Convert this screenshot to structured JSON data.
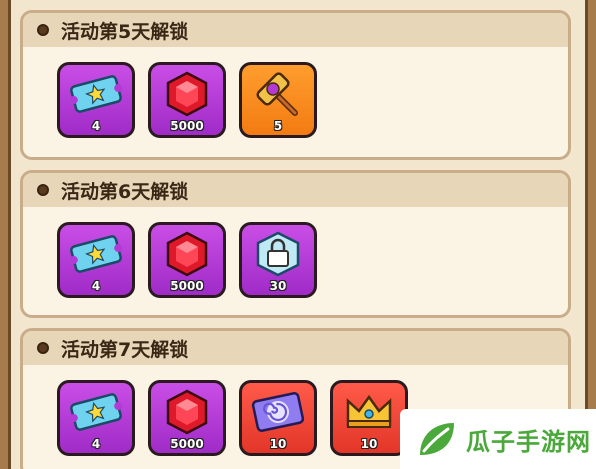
{
  "sections": [
    {
      "title": "活动第5天解锁",
      "items": [
        {
          "icon": "ticket-icon",
          "count": "4",
          "bg": "purple"
        },
        {
          "icon": "ruby-gem-icon",
          "count": "5000",
          "bg": "purple"
        },
        {
          "icon": "hammer-icon",
          "count": "5",
          "bg": "orange"
        }
      ]
    },
    {
      "title": "活动第6天解锁",
      "items": [
        {
          "icon": "ticket-icon",
          "count": "4",
          "bg": "purple"
        },
        {
          "icon": "ruby-gem-icon",
          "count": "5000",
          "bg": "purple"
        },
        {
          "icon": "lock-badge-icon",
          "count": "30",
          "bg": "purple"
        }
      ]
    },
    {
      "title": "活动第7天解锁",
      "items": [
        {
          "icon": "ticket-icon",
          "count": "4",
          "bg": "purple"
        },
        {
          "icon": "ruby-gem-icon",
          "count": "5000",
          "bg": "purple"
        },
        {
          "icon": "swirl-ticket-icon",
          "count": "10",
          "bg": "red"
        },
        {
          "icon": "crown-icon",
          "count": "10",
          "bg": "red"
        }
      ]
    }
  ],
  "watermark": {
    "text": "瓜子手游网",
    "icon": "leaf-logo-icon",
    "color": "#4ba83a"
  }
}
